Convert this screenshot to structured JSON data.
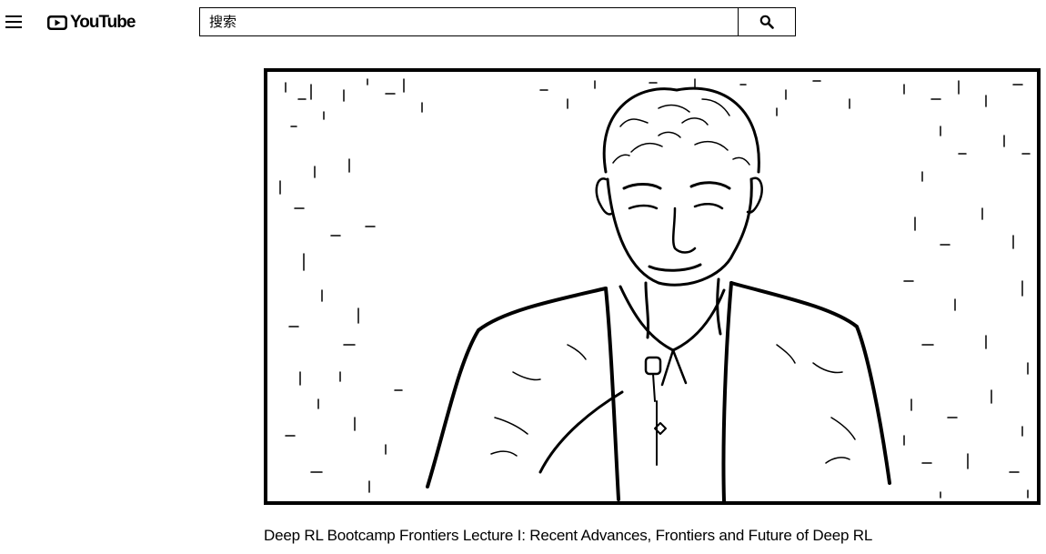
{
  "header": {
    "menu_icon": "hamburger-menu-icon",
    "logo_text": "YouTube",
    "search": {
      "placeholder": "搜索",
      "value": "",
      "button_icon": "search-icon"
    }
  },
  "video": {
    "title": "Deep RL Bootcamp Frontiers Lecture I: Recent Advances, Frontiers and Future of Deep RL"
  }
}
